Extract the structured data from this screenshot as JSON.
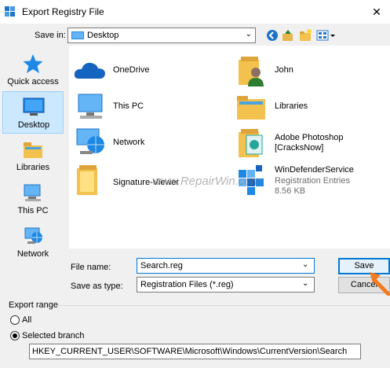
{
  "window": {
    "title": "Export Registry File",
    "close_label": "✕"
  },
  "save_in": {
    "label": "Save in:",
    "value": "Desktop"
  },
  "places": [
    {
      "label": "Quick access",
      "icon": "quick-access-star-icon"
    },
    {
      "label": "Desktop",
      "icon": "desktop-icon",
      "selected": true
    },
    {
      "label": "Libraries",
      "icon": "libraries-icon"
    },
    {
      "label": "This PC",
      "icon": "this-pc-icon"
    },
    {
      "label": "Network",
      "icon": "network-icon"
    }
  ],
  "files": [
    {
      "name": "OneDrive",
      "icon": "onedrive-cloud-icon"
    },
    {
      "name": "John",
      "icon": "user-folder-icon"
    },
    {
      "name": "This PC",
      "icon": "this-pc-icon"
    },
    {
      "name": "Libraries",
      "icon": "libraries-folder-icon"
    },
    {
      "name": "Network",
      "icon": "network-icon"
    },
    {
      "name": "Adobe Photoshop",
      "name2": "[CracksNow]",
      "icon": "photoshop-folder-icon"
    },
    {
      "name": "Signature-Viewer",
      "icon": "folder-icon"
    },
    {
      "name": "WinDefenderService",
      "sub1": "Registration Entries",
      "sub2": "8.56 KB",
      "icon": "registry-file-icon"
    }
  ],
  "file_name": {
    "label": "File name:",
    "value": "Search.reg"
  },
  "save_as_type": {
    "label": "Save as type:",
    "value": "Registration Files (*.reg)"
  },
  "buttons": {
    "save": "Save",
    "cancel": "Cancel"
  },
  "export_range": {
    "label": "Export range",
    "all_label": "All",
    "branch_label": "Selected branch",
    "branch_value": "HKEY_CURRENT_USER\\SOFTWARE\\Microsoft\\Windows\\CurrentVersion\\Search",
    "selected": "Selected branch"
  },
  "watermark": "www.RepairWin.com",
  "colors": {
    "accent": "#0078d7",
    "selection": "#cce8ff",
    "pointer_arrow": "#f57c1f"
  }
}
